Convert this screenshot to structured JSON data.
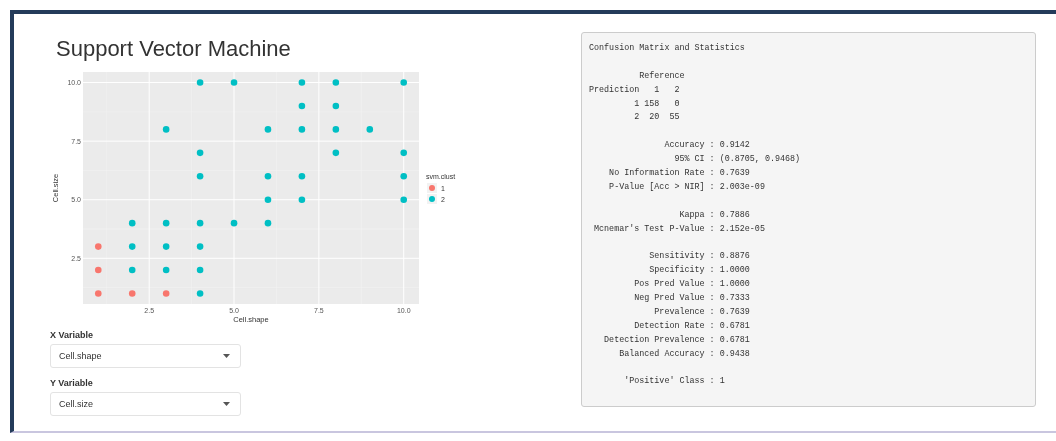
{
  "title": "Support Vector Machine",
  "plot": {
    "chart_data": {
      "type": "scatter",
      "xlabel": "Cell.shape",
      "ylabel": "Cell.size",
      "xlim": [
        0.55,
        10.45
      ],
      "ylim": [
        0.55,
        10.45
      ],
      "xticks": [
        {
          "value": 2.5,
          "label": "2.5"
        },
        {
          "value": 5,
          "label": "5.0"
        },
        {
          "value": 7.5,
          "label": "7.5"
        },
        {
          "value": 10,
          "label": "10.0"
        }
      ],
      "yticks": [
        {
          "value": 2.5,
          "label": "2.5"
        },
        {
          "value": 5,
          "label": "5.0"
        },
        {
          "value": 7.5,
          "label": "7.5"
        },
        {
          "value": 10,
          "label": "10.0"
        }
      ],
      "legend_title": "svm.clust",
      "legend": "right",
      "grid": true,
      "x": [
        1,
        1,
        1,
        2,
        3,
        4,
        5,
        7,
        8,
        10,
        7,
        8,
        3,
        6,
        7,
        8,
        9,
        4,
        8,
        10,
        4,
        6,
        7,
        10,
        6,
        7,
        10,
        2,
        3,
        4,
        5,
        6,
        2,
        3,
        4,
        2,
        3,
        4,
        4
      ],
      "series": [
        {
          "name": "1",
          "color": "#f8766d",
          "values": [
            3,
            2,
            1,
            1,
            1,
            null,
            null,
            null,
            null,
            null,
            null,
            null,
            null,
            null,
            null,
            null,
            null,
            null,
            null,
            null,
            null,
            null,
            null,
            null,
            null,
            null,
            null,
            null,
            null,
            null,
            null,
            null,
            null,
            null,
            null,
            null,
            null,
            null,
            null
          ]
        },
        {
          "name": "2",
          "color": "#00bfc4",
          "values": [
            null,
            null,
            null,
            null,
            null,
            10,
            10,
            10,
            10,
            10,
            9,
            9,
            8,
            8,
            8,
            8,
            8,
            7,
            7,
            7,
            6,
            6,
            6,
            6,
            5,
            5,
            5,
            4,
            4,
            4,
            4,
            4,
            3,
            3,
            3,
            2,
            2,
            2,
            1
          ]
        }
      ]
    }
  },
  "selects": [
    {
      "label": "X Variable",
      "value": "Cell.shape"
    },
    {
      "label": "Y Variable",
      "value": "Cell.size"
    }
  ],
  "output": [
    [
      "Confusion Matrix and Statistics"
    ],
    [
      "          Reference",
      "Prediction   1   2",
      "         1 158   0",
      "         2  20  55"
    ],
    [
      "               Accuracy : 0.9142",
      "                 95% CI : (0.8705, 0.9468)",
      "    No Information Rate : 0.7639",
      "    P-Value [Acc > NIR] : 2.003e-09"
    ],
    [
      "                  Kappa : 0.7886",
      " Mcnemar's Test P-Value : 2.152e-05"
    ],
    [
      "            Sensitivity : 0.8876",
      "            Specificity : 1.0000",
      "         Pos Pred Value : 1.0000",
      "         Neg Pred Value : 0.7333",
      "             Prevalence : 0.7639",
      "         Detection Rate : 0.6781",
      "   Detection Prevalence : 0.6781",
      "      Balanced Accuracy : 0.9438"
    ],
    [
      "       'Positive' Class : 1"
    ]
  ]
}
